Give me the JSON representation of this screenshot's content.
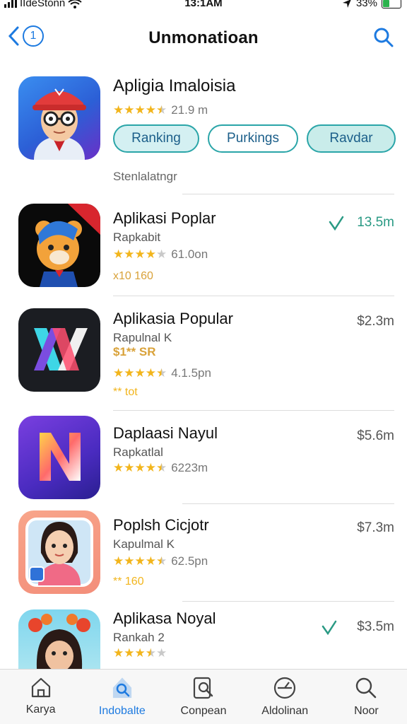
{
  "status_bar": {
    "carrier": "IIdeStonn",
    "time": "13:1AM",
    "battery": "33%",
    "battery_level": 0.33
  },
  "nav": {
    "title": "Unmonatioan",
    "back_icon": "chevron-left-icon",
    "search_icon": "search-icon"
  },
  "featured": {
    "name": "Apligia Imaloisia",
    "rating_stars": 4.5,
    "rating_text": "21.9 m",
    "pills": [
      "Ranking",
      "Purkings",
      "Ravdar"
    ],
    "subtitle": "Stenlalatngr"
  },
  "apps": [
    {
      "name": "Aplikasi Poplar",
      "category": "Rapkabit",
      "rating_stars": 4,
      "rating_text": "61.0on",
      "extra": "x10 160",
      "price": "13.5m",
      "price_icon": "download-icon"
    },
    {
      "name": "Aplikasia Popular",
      "category": "Rapulnal K",
      "rating_label": "$1** SR",
      "rating_stars": 4.5,
      "rating_text": "4.1.5pn",
      "extra": "** tot",
      "price": "$2.3m"
    },
    {
      "name": "Daplaasi Nayul",
      "category": "Rapkatlal",
      "rating_stars": 4.5,
      "rating_text": "6223m",
      "price": "$5.6m"
    },
    {
      "name": "Poplsh Cicjotr",
      "category": "Kapulmal K",
      "rating_stars": 4.5,
      "rating_text": "62.5pn",
      "extra": "** 160",
      "price": "$7.3m"
    },
    {
      "name": "Aplikasa Noyal",
      "category": "Rankah 2",
      "rating_stars": 3.5,
      "rating_text": "",
      "price": "$3.5m",
      "price_icon": "download-icon"
    }
  ],
  "tabs": [
    {
      "label": "Karya",
      "icon": "home-icon",
      "active": false
    },
    {
      "label": "Indobalte",
      "icon": "discover-icon",
      "active": true
    },
    {
      "label": "Conpean",
      "icon": "search-doc-icon",
      "active": false
    },
    {
      "label": "Aldolinan",
      "icon": "compass-icon",
      "active": false
    },
    {
      "label": "Noor",
      "icon": "search-icon",
      "active": false
    }
  ],
  "colors": {
    "accent": "#1d7ae0",
    "star": "#f2b51c",
    "pill_border": "#2aa5a8",
    "price_green": "#2a9a84"
  }
}
